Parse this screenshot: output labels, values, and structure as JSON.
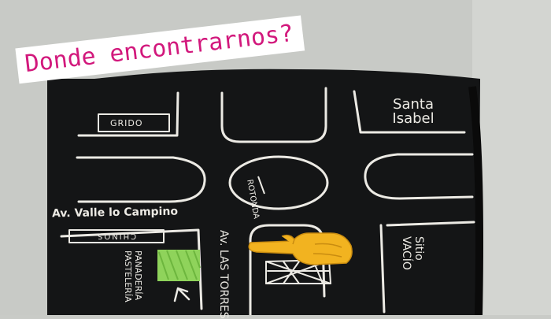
{
  "banner": {
    "text": "Donde encontrarnos?"
  },
  "map": {
    "labels": {
      "grido": "GRIDO",
      "santa_isabel": "Santa Isabel",
      "rotonda": "ROTONDA",
      "avenue_valle": "Av. Valle lo Campino",
      "chinos": "CHINOS",
      "avenue_torres": "Av. LAS TORRES",
      "panaderia": "PANADERÍA PASTELERÍA",
      "sitio": "Sitio VACÍO"
    },
    "icons": [
      "pointing-hand-icon",
      "arrow-up-icon",
      "building-icon"
    ]
  },
  "colors": {
    "board": "#141516",
    "chalk": "#eceae4",
    "banner_text": "#d2187c",
    "banner_bg": "#ffffff",
    "green_block": "#8fd35b",
    "hand": "#f2b320"
  }
}
